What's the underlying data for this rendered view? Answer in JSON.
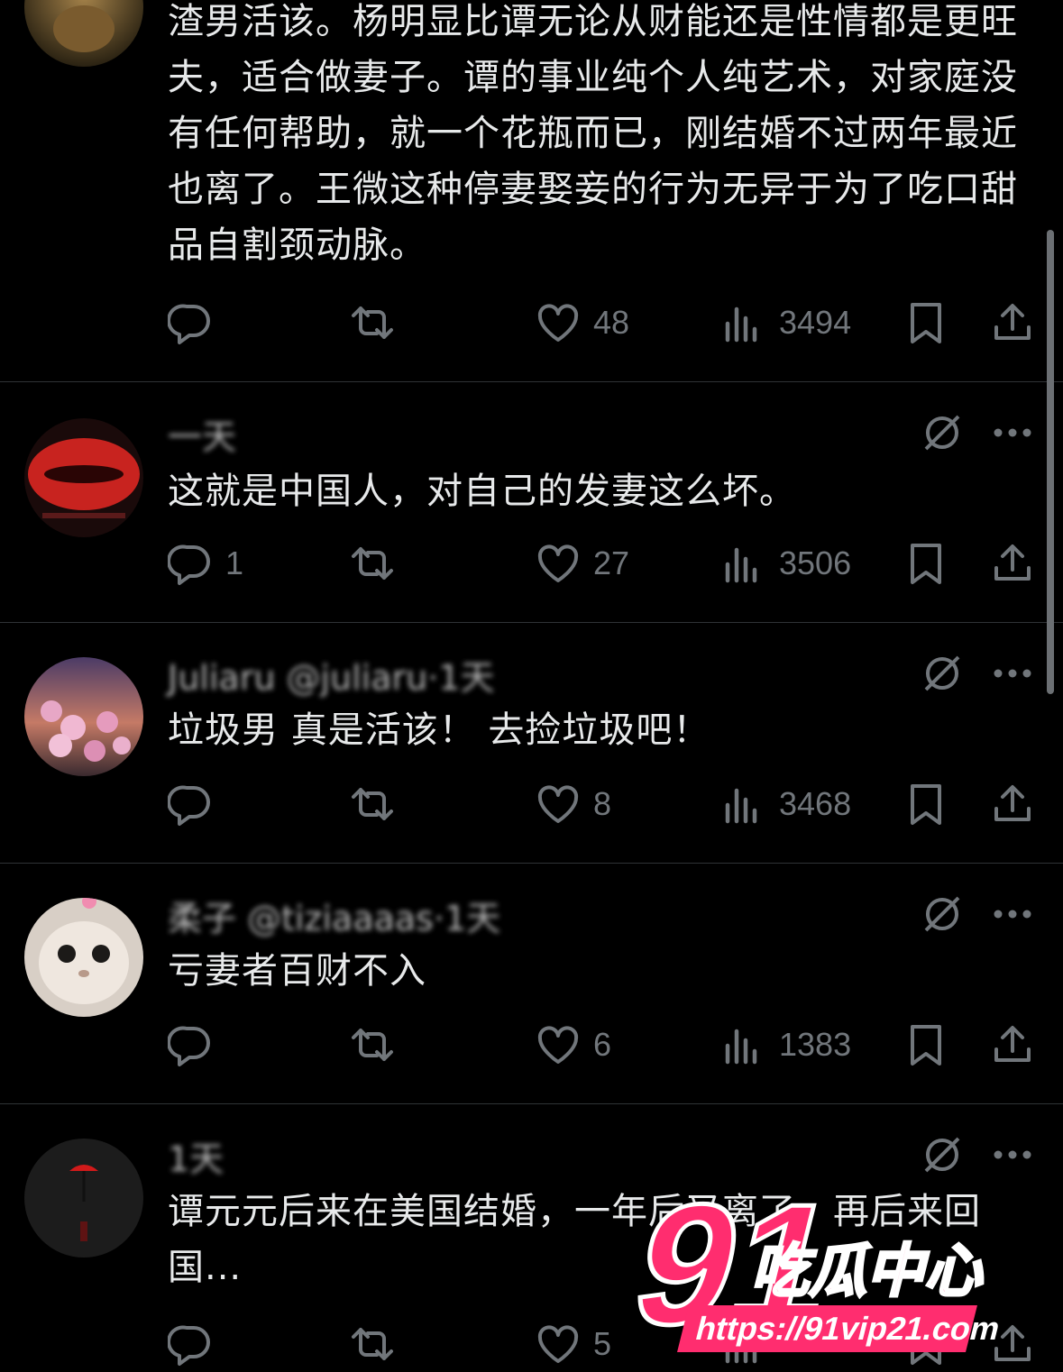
{
  "posts": [
    {
      "header": "",
      "text": "渣男活该。杨明显比谭无论从财能还是性情都是更旺夫，适合做妻子。谭的事业纯个人纯艺术，对家庭没有任何帮助，就一个花瓶而已，刚结婚不过两年最近也离了。王微这种停妻娶妾的行为无异于为了吃口甜品自割颈动脉。",
      "replies": "",
      "likes": "48",
      "views": "3494",
      "avatar": "lion-avatar"
    },
    {
      "header": "一天",
      "text": "这就是中国人，对自己的发妻这么坏。",
      "replies": "1",
      "likes": "27",
      "views": "3506",
      "avatar": "lips-avatar"
    },
    {
      "header": "Juliaru @juliaru·1天",
      "text": "垃圾男 真是活该！ 去捡垃圾吧！",
      "replies": "",
      "likes": "8",
      "views": "3468",
      "avatar": "roses-avatar"
    },
    {
      "header": "柔子 @tiziaaaas·1天",
      "text": "亏妻者百财不入",
      "replies": "",
      "likes": "6",
      "views": "1383",
      "avatar": "cat-avatar"
    },
    {
      "header": "1天",
      "text": "谭元元后来在美国结婚，一年后又离了，再后来回国...",
      "replies": "",
      "likes": "5",
      "views": "",
      "avatar": "umbrella-avatar"
    }
  ],
  "watermark": {
    "number": "91",
    "brand": "吃瓜中心",
    "url": "https://91vip21.com",
    "color": "#ff2d6f"
  }
}
